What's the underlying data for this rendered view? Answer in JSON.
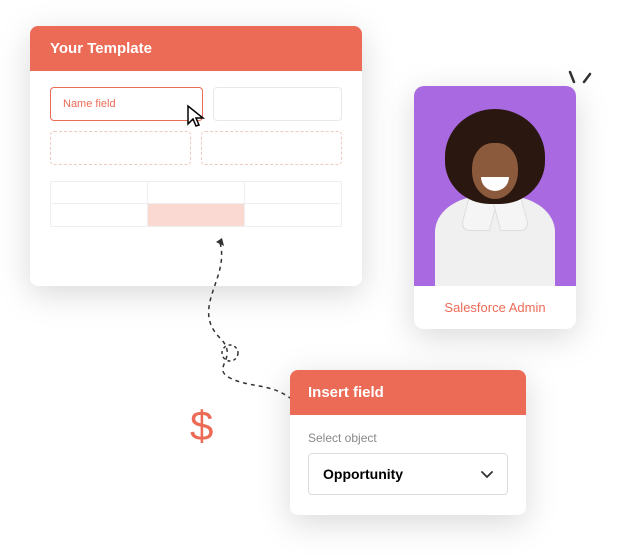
{
  "template": {
    "title": "Your Template",
    "name_field_label": "Name field"
  },
  "avatar": {
    "role": "Salesforce Admin"
  },
  "insert": {
    "title": "Insert field",
    "select_label": "Select object",
    "selected_value": "Opportunity"
  },
  "decorations": {
    "dollar": "$"
  },
  "colors": {
    "accent": "#ec6b56",
    "avatar_bg": "#a969e0"
  }
}
